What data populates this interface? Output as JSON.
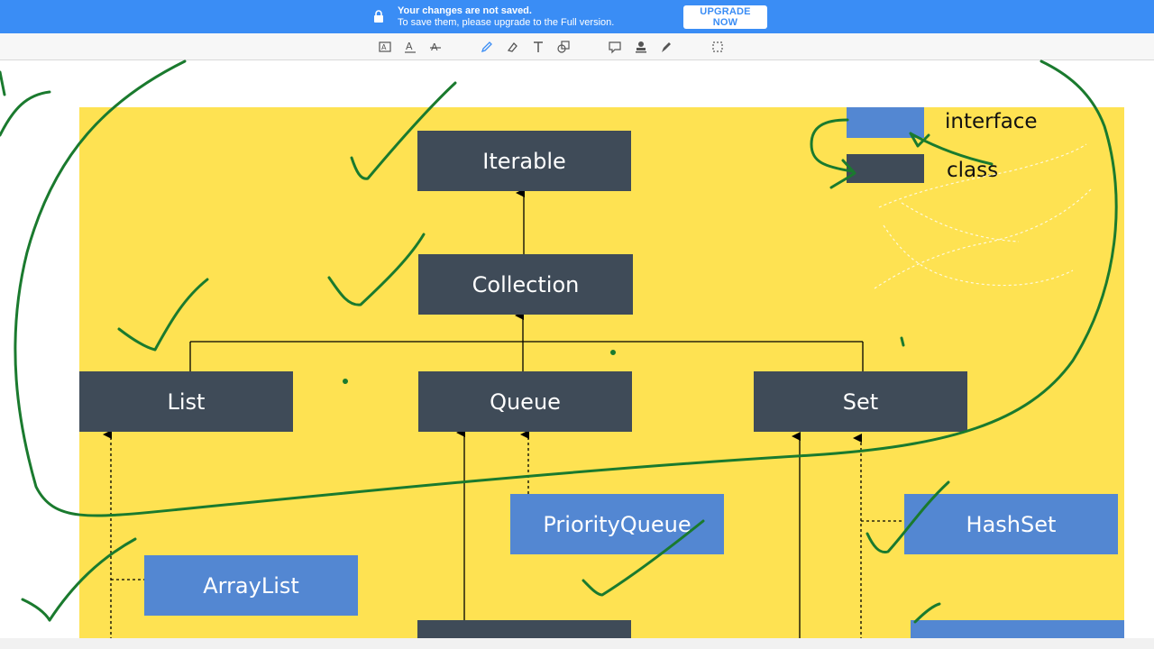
{
  "banner": {
    "title": "Your changes are not saved.",
    "subtitle": "To save them, please upgrade to the Full version.",
    "upgrade_label": "UPGRADE NOW",
    "color": "#3a8df5"
  },
  "toolbar": {
    "tools": [
      "text-format-icon",
      "text-underline-icon",
      "text-strikethrough-icon",
      "pencil-icon",
      "eraser-icon",
      "text-tool-icon",
      "shapes-icon",
      "comment-icon",
      "stamp-icon",
      "pen-icon",
      "selection-icon"
    ]
  },
  "diagram": {
    "legend": {
      "interface_label": "interface",
      "class_label": "class"
    },
    "nodes": {
      "iterable": "Iterable",
      "collection": "Collection",
      "list": "List",
      "queue": "Queue",
      "set": "Set",
      "priority_queue": "PriorityQueue",
      "hash_set": "HashSet",
      "array_list": "ArrayList"
    },
    "colors": {
      "background": "#fee252",
      "interface": "#3f4b58",
      "class": "#5387d2",
      "ink": "#1a7a2e"
    }
  }
}
